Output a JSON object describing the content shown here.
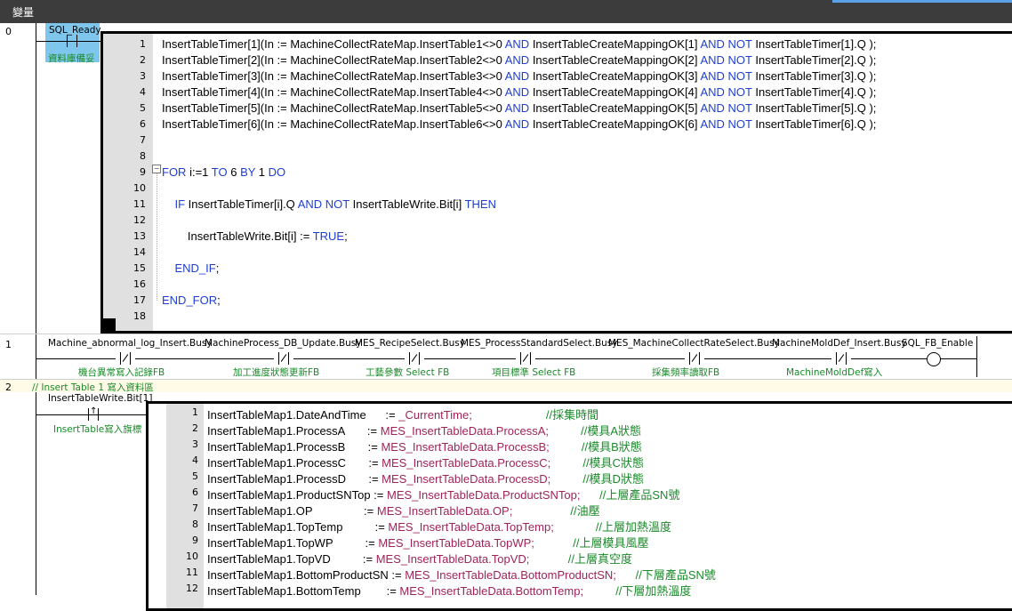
{
  "panel": {
    "title": "變量"
  },
  "rungs": [
    {
      "num": "0"
    },
    {
      "num": "1"
    },
    {
      "num": "2"
    }
  ],
  "rung0": {
    "contact_var": "SQL_Ready",
    "contact_comment": "資料庫備妥",
    "st_lines": [
      "InsertTableTimer[1](In := MachineCollectRateMap.InsertTable1<>0 AND InsertTableCreateMappingOK[1] AND NOT InsertTableTimer[1].Q );",
      "InsertTableTimer[2](In := MachineCollectRateMap.InsertTable2<>0 AND InsertTableCreateMappingOK[2] AND NOT InsertTableTimer[2].Q );",
      "InsertTableTimer[3](In := MachineCollectRateMap.InsertTable3<>0 AND InsertTableCreateMappingOK[3] AND NOT InsertTableTimer[3].Q );",
      "InsertTableTimer[4](In := MachineCollectRateMap.InsertTable4<>0 AND InsertTableCreateMappingOK[4] AND NOT InsertTableTimer[4].Q );",
      "InsertTableTimer[5](In := MachineCollectRateMap.InsertTable5<>0 AND InsertTableCreateMappingOK[5] AND NOT InsertTableTimer[5].Q );",
      "InsertTableTimer[6](In := MachineCollectRateMap.InsertTable6<>0 AND InsertTableCreateMappingOK[6] AND NOT InsertTableTimer[6].Q );",
      "",
      "",
      "FOR i:=1 TO 6 BY 1 DO",
      "",
      "    IF InsertTableTimer[i].Q AND NOT InsertTableWrite.Bit[i] THEN",
      "",
      "        InsertTableWrite.Bit[i] := TRUE;",
      "",
      "    END_IF;",
      "",
      "END_FOR;",
      ""
    ]
  },
  "rung1": {
    "contacts": [
      {
        "var": "Machine_abnormal_log_Insert.Busy",
        "comment": "機台異常寫入記錄FB"
      },
      {
        "var": "MachineProcess_DB_Update.Busy",
        "comment": "加工進度狀態更新FB"
      },
      {
        "var": "MES_RecipeSelect.Busy",
        "comment": "工藝參數 Select FB"
      },
      {
        "var": "MES_ProcessStandardSelect.Busy",
        "comment": "項目標準 Select FB"
      },
      {
        "var": "MES_MachineCollectRateSelect.Busy",
        "comment": "採集頻率讀取FB"
      },
      {
        "var": "MachineMoldDef_Insert.Busy",
        "comment": "MachineMoldDef寫入"
      }
    ],
    "coil_var": "SQL_FB_Enable"
  },
  "rung2": {
    "comment": "//  Insert Table 1 寫入資料區",
    "contact_var": "InsertTableWrite.Bit[1]",
    "contact_comment": "InsertTable寫入旗標",
    "st_lines": [
      {
        "lhs": "InsertTableMap1.DateAndTime",
        "pad": "      ",
        "op": ":= ",
        "rhs": "_CurrentTime;",
        "pad2": "                       ",
        "cm": "//採集時間"
      },
      {
        "lhs": "InsertTableMap1.ProcessA",
        "pad": "       ",
        "op": ":= ",
        "rhs": "MES_InsertTableData.ProcessA;",
        "pad2": "          ",
        "cm": "//模具A狀態"
      },
      {
        "lhs": "InsertTableMap1.ProcessB",
        "pad": "       ",
        "op": ":= ",
        "rhs": "MES_InsertTableData.ProcessB;",
        "pad2": "          ",
        "cm": "//模具B狀態"
      },
      {
        "lhs": "InsertTableMap1.ProcessC",
        "pad": "       ",
        "op": ":= ",
        "rhs": "MES_InsertTableData.ProcessC;",
        "pad2": "          ",
        "cm": "//模具C狀態"
      },
      {
        "lhs": "InsertTableMap1.ProcessD",
        "pad": "       ",
        "op": ":= ",
        "rhs": "MES_InsertTableData.ProcessD;",
        "pad2": "          ",
        "cm": "//模具D狀態"
      },
      {
        "lhs": "InsertTableMap1.ProductSNTop",
        "pad": " ",
        "op": ":= ",
        "rhs": "MES_InsertTableData.ProductSNTop;",
        "pad2": "      ",
        "cm": "//上層產品SN號"
      },
      {
        "lhs": "InsertTableMap1.OP",
        "pad": "                ",
        "op": ":= ",
        "rhs": "MES_InsertTableData.OP;",
        "pad2": "                  ",
        "cm": "//油壓"
      },
      {
        "lhs": "InsertTableMap1.TopTemp",
        "pad": "          ",
        "op": ":= ",
        "rhs": "MES_InsertTableData.TopTemp;",
        "pad2": "             ",
        "cm": "//上層加熱溫度"
      },
      {
        "lhs": "InsertTableMap1.TopWP",
        "pad": "          ",
        "op": ":= ",
        "rhs": "MES_InsertTableData.TopWP;",
        "pad2": "            ",
        "cm": "//上層模具風壓"
      },
      {
        "lhs": "InsertTableMap1.TopVD",
        "pad": "          ",
        "op": ":= ",
        "rhs": "MES_InsertTableData.TopVD;",
        "pad2": "            ",
        "cm": "//上層真空度"
      },
      {
        "lhs": "InsertTableMap1.BottomProductSN",
        "pad": " ",
        "op": ":= ",
        "rhs": "MES_InsertTableData.BottomProductSN;",
        "pad2": "      ",
        "cm": "//下層產品SN號"
      },
      {
        "lhs": "InsertTableMap1.BottomTemp",
        "pad": "        ",
        "op": ":= ",
        "rhs": "MES_InsertTableData.BottomTemp;",
        "pad2": "          ",
        "cm": "//下層加熱溫度"
      }
    ]
  }
}
